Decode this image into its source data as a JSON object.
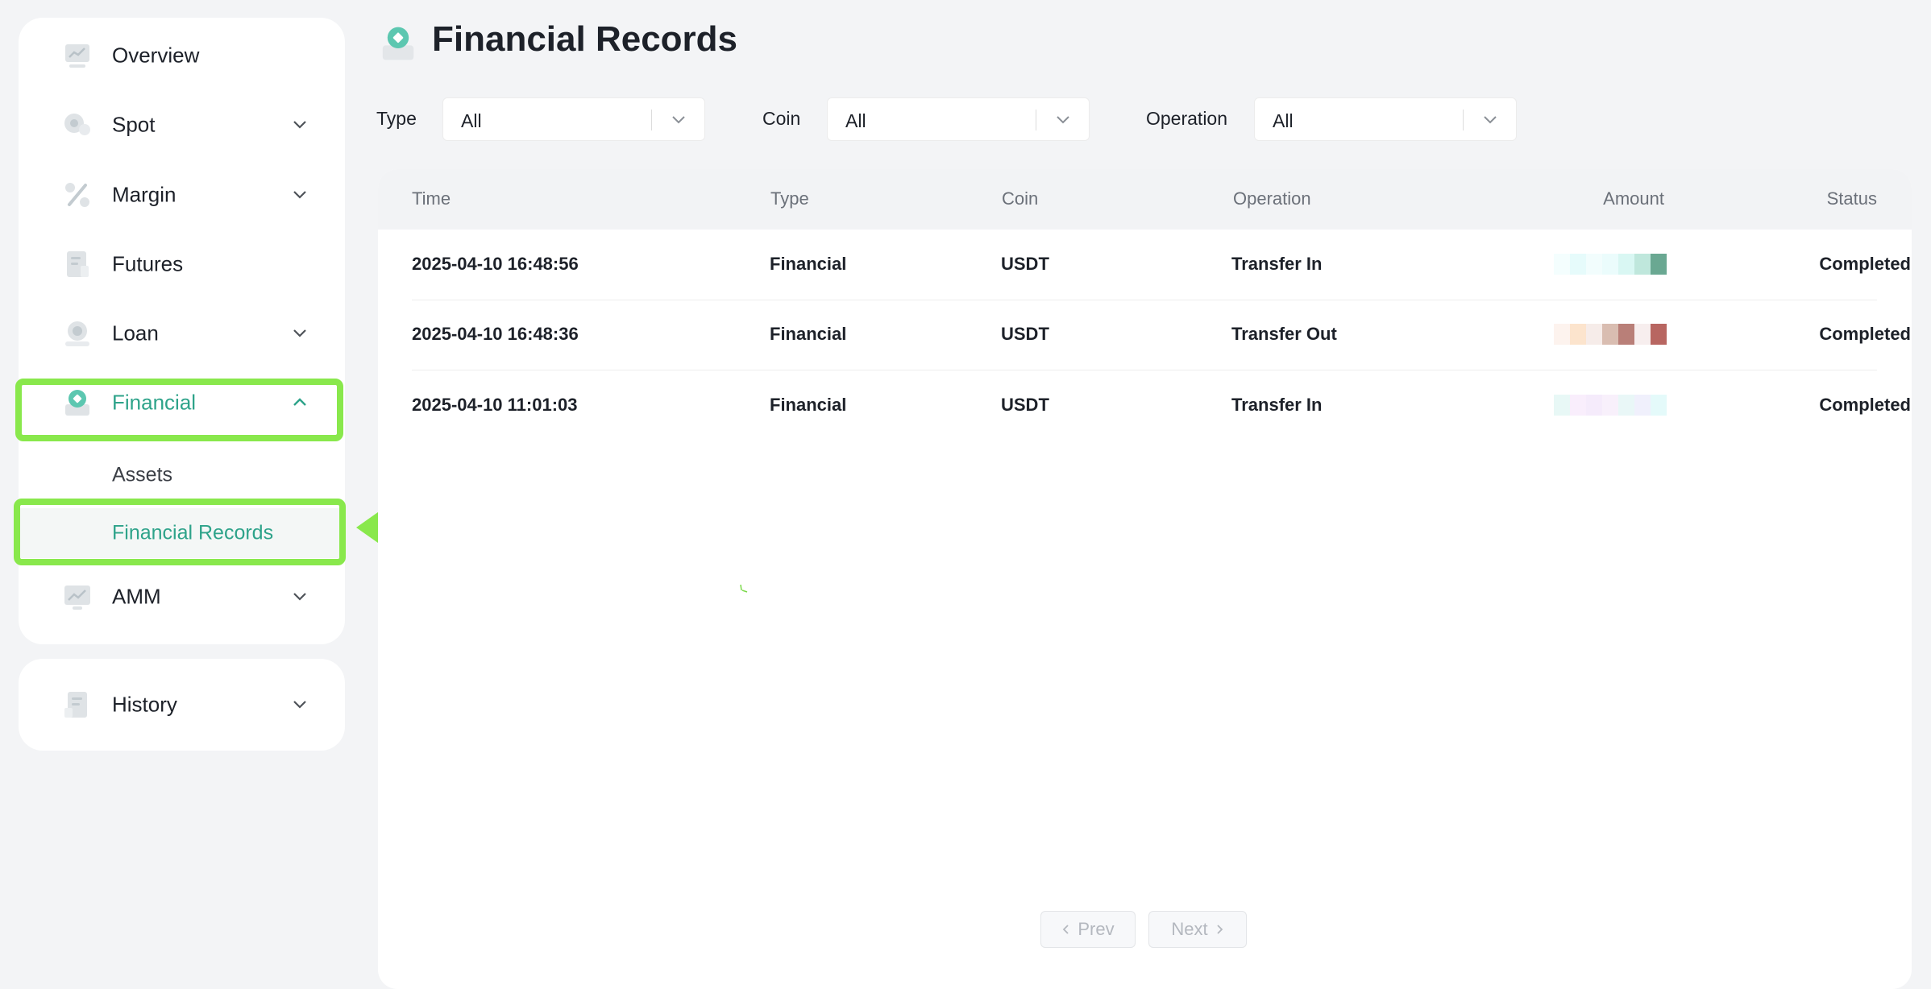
{
  "sidebar": {
    "items": [
      {
        "label": "Overview",
        "icon": "chart-board-icon",
        "has_chevron": false
      },
      {
        "label": "Spot",
        "icon": "coins-icon",
        "has_chevron": true
      },
      {
        "label": "Margin",
        "icon": "percent-icon",
        "has_chevron": true
      },
      {
        "label": "Futures",
        "icon": "document-icon",
        "has_chevron": true
      },
      {
        "label": "Loan",
        "icon": "coin-hand-icon",
        "has_chevron": true
      },
      {
        "label": "Financial",
        "icon": "wallet-icon",
        "has_chevron": true,
        "expanded": true,
        "active": true
      },
      {
        "label": "AMM",
        "icon": "trend-board-icon",
        "has_chevron": true
      }
    ],
    "financial_sub": [
      {
        "label": "Assets",
        "selected": false
      },
      {
        "label": "Financial Records",
        "selected": true
      }
    ],
    "history": {
      "label": "History",
      "icon": "receipt-icon"
    }
  },
  "header": {
    "title": "Financial Records",
    "icon": "wallet-icon"
  },
  "filters": {
    "type": {
      "label": "Type",
      "value": "All"
    },
    "coin": {
      "label": "Coin",
      "value": "All"
    },
    "operation": {
      "label": "Operation",
      "value": "All"
    }
  },
  "table": {
    "columns": [
      "Time",
      "Type",
      "Coin",
      "Operation",
      "Amount",
      "Status"
    ],
    "rows": [
      {
        "time": "2025-04-10 16:48:56",
        "type": "Financial",
        "coin": "USDT",
        "operation": "Transfer In",
        "status": "Completed"
      },
      {
        "time": "2025-04-10 16:48:36",
        "type": "Financial",
        "coin": "USDT",
        "operation": "Transfer Out",
        "status": "Completed"
      },
      {
        "time": "2025-04-10 11:01:03",
        "type": "Financial",
        "coin": "USDT",
        "operation": "Transfer In",
        "status": "Completed"
      }
    ]
  },
  "pagination": {
    "prev": "Prev",
    "next": "Next"
  },
  "colors": {
    "accent": "#2ea38a",
    "highlight": "#89e84c",
    "page_bg": "#f3f4f6"
  }
}
